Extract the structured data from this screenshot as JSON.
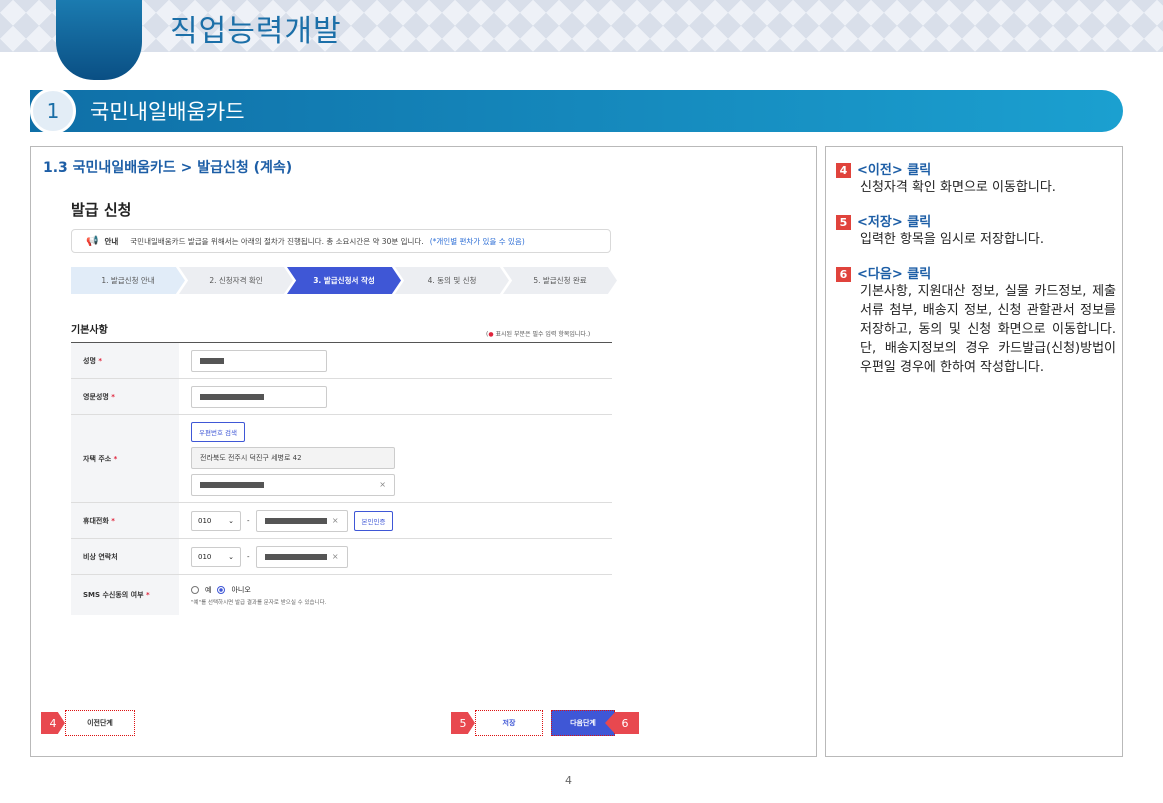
{
  "header": {
    "title": "직업능력개발"
  },
  "section": {
    "number": "1",
    "title": "국민내일배움카드"
  },
  "main": {
    "subtitle": "1.3 국민내일배움카드 > 발급신청 (계속)",
    "issue_title": "발급 신청",
    "notice": {
      "label": "안내",
      "text": "국민내일배움카드 발급을 위해서는 아래의 절차가 진행됩니다. 총 소요시간은 약 30분 입니다.",
      "emphasis": "(*개인별 편차가 있을 수 있음)"
    },
    "steps": [
      {
        "label": "1. 발급신청 안내"
      },
      {
        "label": "2. 신청자격 확인"
      },
      {
        "label": "3. 발급신청서 작성"
      },
      {
        "label": "4. 동의 및 신청"
      },
      {
        "label": "5. 발급신청 완료"
      }
    ],
    "basic_title": "기본사항",
    "required_note": "표시된 부분은 필수 입력 항목입니다.",
    "required_note_open": "(",
    "required_note_close": ")",
    "required_dot": "●",
    "req_mark": "*",
    "fields": {
      "name": {
        "label": "성명"
      },
      "eng_name": {
        "label": "영문성명"
      },
      "address": {
        "label": "자택 주소",
        "search_button": "우편번호 검색",
        "line1": "전라북도 전주시 덕진구 세병로 42"
      },
      "mobile": {
        "label": "휴대전화",
        "prefix": "010",
        "dash": "-",
        "verify_button": "본인인증"
      },
      "emergency": {
        "label": "비상 연락처",
        "prefix": "010",
        "dash": "-"
      },
      "sms": {
        "label": "SMS 수신동의 여부",
        "option_yes": "예",
        "option_no": "아니오",
        "selected": "아니오",
        "note": "\"예\"를 선택하시면 발급 결과를 문자로 받으실 수 있습니다."
      }
    },
    "buttons": {
      "prev": "이전단계",
      "save": "저장",
      "next": "다음단계"
    },
    "markers": {
      "prev": "4",
      "save": "5",
      "next": "6"
    }
  },
  "side": {
    "items": [
      {
        "num": "4",
        "head": "<이전> 클릭",
        "desc": "신청자격 확인 화면으로 이동합니다."
      },
      {
        "num": "5",
        "head": "<저장> 클릭",
        "desc": "입력한 항목을 임시로 저장합니다."
      },
      {
        "num": "6",
        "head": "<다음> 클릭",
        "desc": "기본사항, 지원대산 정보, 실물 카드정보, 제출서류 첨부, 배송지 정보, 신청 관할관서 정보를 저장하고, 동의 및 신청 화면으로 이동합니다. 단, 배송지정보의 경우 카드발급(신청)방법이 우편일 경우에 한하여 작성합니다."
      }
    ]
  },
  "page_number": "4",
  "colors": {
    "primary": "#1b6fa8",
    "step_active": "#3f57d6",
    "marker": "#e8484f",
    "heading": "#1d5ea6"
  }
}
